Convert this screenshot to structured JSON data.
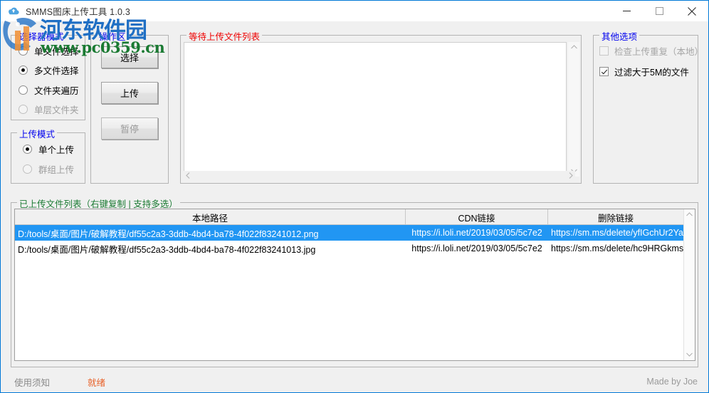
{
  "window": {
    "title": "SMMS图床上传工具 1.0.3",
    "icon": "cloud-upload-icon",
    "minimize": "—",
    "maximize": "▢",
    "close": "✕",
    "accent_color": "#0078d7"
  },
  "watermark": {
    "line1": "河东软件园",
    "line2": "www.pc0359.cn",
    "line1_color": "#1f6fc4",
    "line2_color": "#1a7a32"
  },
  "selector_mode": {
    "legend": "选择器模式",
    "legend_color": "#0000ee",
    "options": [
      {
        "label": "单文件选择",
        "checked": false,
        "disabled": false
      },
      {
        "label": "多文件选择",
        "checked": true,
        "disabled": false
      },
      {
        "label": "文件夹遍历",
        "checked": false,
        "disabled": false
      },
      {
        "label": "单层文件夹",
        "checked": false,
        "disabled": true
      }
    ]
  },
  "upload_mode": {
    "legend": "上传模式",
    "legend_color": "#0000ee",
    "options": [
      {
        "label": "单个上传",
        "checked": true,
        "disabled": false
      },
      {
        "label": "群组上传",
        "checked": false,
        "disabled": true
      }
    ]
  },
  "operation_area": {
    "legend": "操作区",
    "legend_color": "#0000ee",
    "buttons": [
      {
        "label": "选择",
        "disabled": false
      },
      {
        "label": "上传",
        "disabled": false
      },
      {
        "label": "暂停",
        "disabled": true
      }
    ]
  },
  "pending_list": {
    "legend": "等待上传文件列表",
    "legend_color": "#ee0000",
    "items": [],
    "scroll_up": "⌃",
    "scroll_down": "⌄",
    "scroll_left": "‹",
    "scroll_right": "›"
  },
  "other_options": {
    "legend": "其他选项",
    "legend_color": "#0000ee",
    "options": [
      {
        "label": "检查上传重复（本地）",
        "checked": false,
        "disabled": true
      },
      {
        "label": "过滤大于5M的文件",
        "checked": true,
        "disabled": false
      }
    ]
  },
  "uploaded_list": {
    "legend": "已上传文件列表（右键复制 | 支持多选）",
    "legend_color": "#1a7a32",
    "columns": [
      "本地路径",
      "CDN链接",
      "删除链接"
    ],
    "rows": [
      {
        "selected": true,
        "local_path": "D:/tools/桌面/图片/破解教程/df55c2a3-3ddb-4bd4-ba78-4f022f83241012.png",
        "cdn_link": "https://i.loli.net/2019/03/05/5c7e2",
        "delete_link": "https://sm.ms/delete/yfIGchUr2Ya"
      },
      {
        "selected": false,
        "local_path": "D:/tools/桌面/图片/破解教程/df55c2a3-3ddb-4bd4-ba78-4f022f83241013.jpg",
        "cdn_link": "https://i.loli.net/2019/03/05/5c7e2",
        "delete_link": "https://sm.ms/delete/hc9HRGkms"
      }
    ],
    "scroll_up": "⌃",
    "scroll_down": "⌄",
    "selection_color": "#2196f3"
  },
  "status_bar": {
    "help_link": "使用须知",
    "state": "就绪",
    "state_color": "#e8622a",
    "credit": "Made by Joe"
  }
}
